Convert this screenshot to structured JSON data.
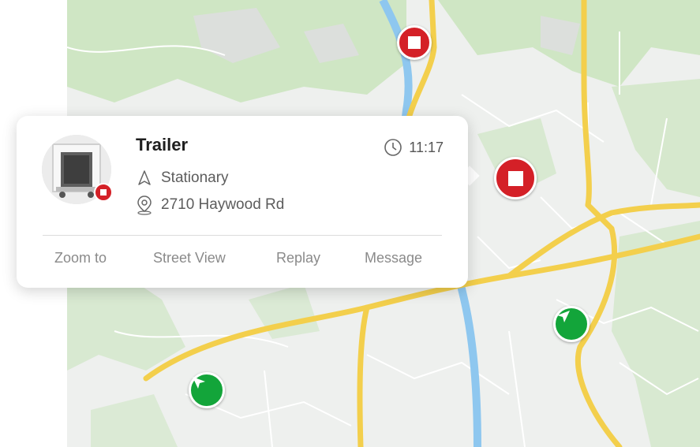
{
  "vehicle_card": {
    "name": "Trailer",
    "time": "11:17",
    "status": "Stationary",
    "address": "2710 Haywood Rd",
    "status_badge": "stopped",
    "actions": [
      "Zoom to",
      "Street View",
      "Replay",
      "Message"
    ]
  },
  "markers": [
    {
      "state": "stopped",
      "icon": "stop-icon"
    },
    {
      "state": "stopped",
      "icon": "stop-icon",
      "selected": true
    },
    {
      "state": "moving",
      "icon": "navigation-arrow-icon"
    },
    {
      "state": "moving",
      "icon": "navigation-arrow-icon"
    }
  ],
  "colors": {
    "stopped": "#d42027",
    "moving": "#13a53a",
    "road": "#f3cf4c",
    "river": "#8ec7ef",
    "park": "#cfe6c4",
    "map_base": "#eef0ee"
  }
}
